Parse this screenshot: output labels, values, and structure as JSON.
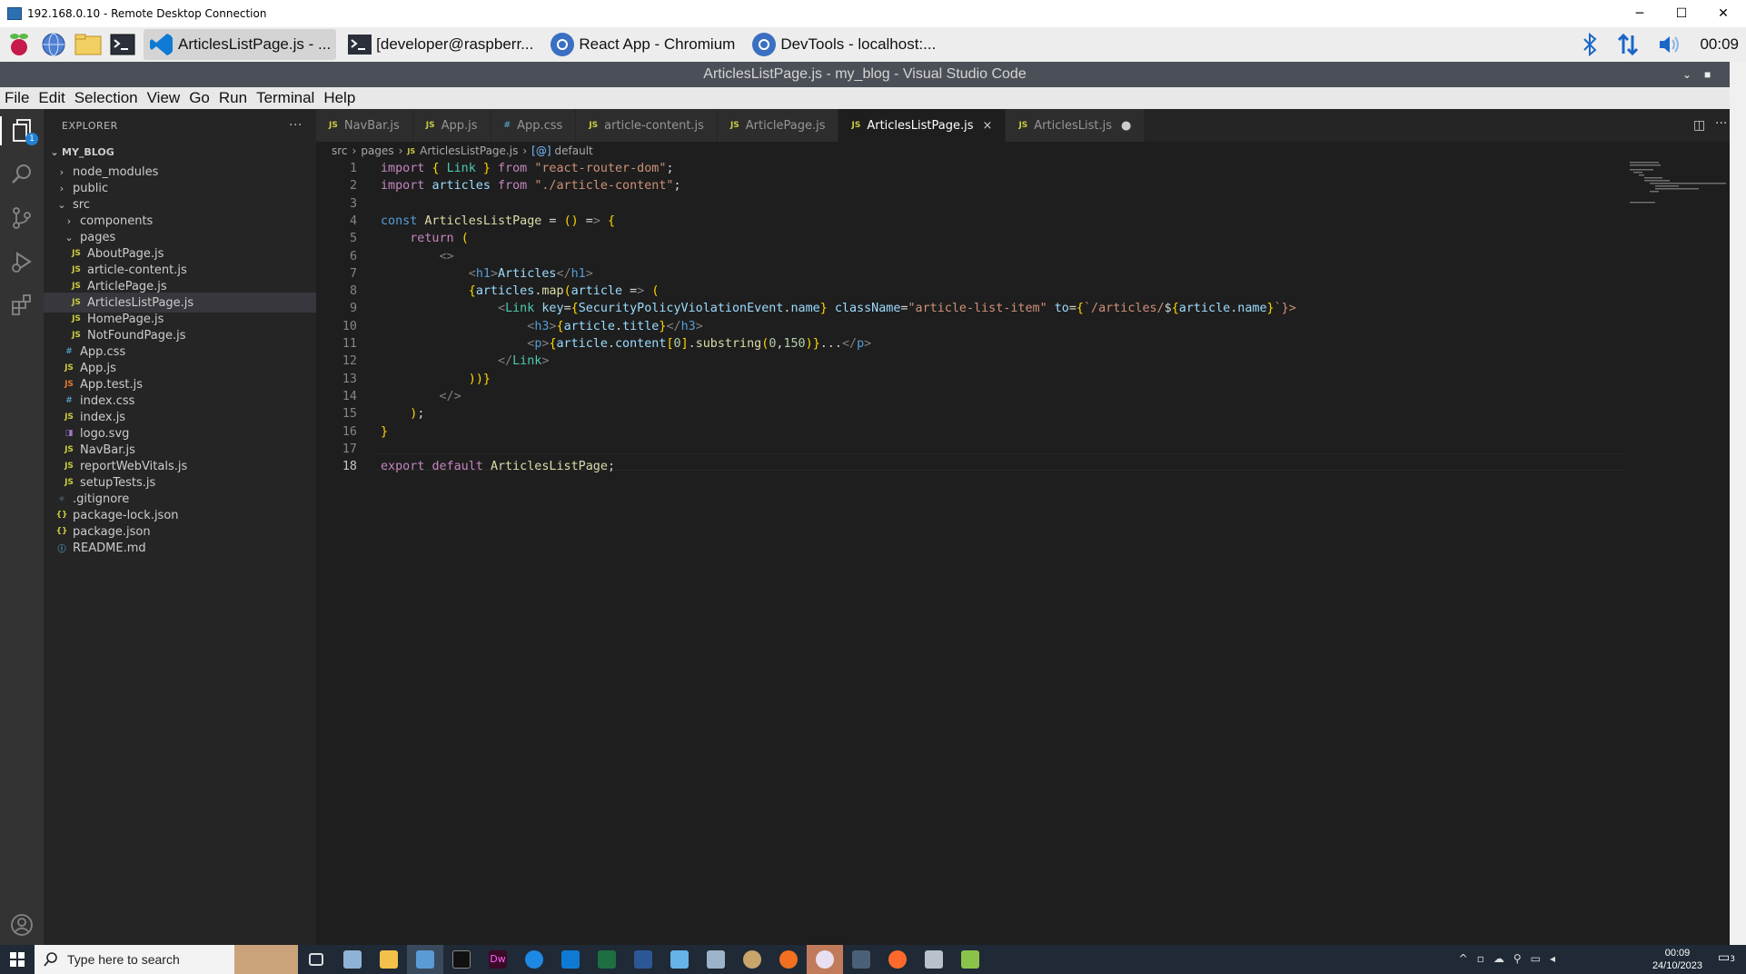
{
  "rdp": {
    "title": "192.168.0.10 - Remote Desktop Connection",
    "minimize": "─",
    "maximize": "☐",
    "close": "✕"
  },
  "pi_taskbar": {
    "tasks": [
      {
        "label": "ArticlesListPage.js - ..."
      },
      {
        "label": "[developer@raspberr..."
      },
      {
        "label": "React App - Chromium"
      },
      {
        "label": "DevTools - localhost:..."
      }
    ],
    "clock": "00:09"
  },
  "vscode": {
    "title": "ArticlesListPage.js - my_blog - Visual Studio Code",
    "menu": [
      "File",
      "Edit",
      "Selection",
      "View",
      "Go",
      "Run",
      "Terminal",
      "Help"
    ],
    "explorer": {
      "header": "EXPLORER",
      "more": "···",
      "root": "MY_BLOG",
      "source_control_badge": "1",
      "items": [
        {
          "label": "node_modules",
          "kind": "folder",
          "level": 1,
          "open": false
        },
        {
          "label": "public",
          "kind": "folder",
          "level": 1,
          "open": false
        },
        {
          "label": "src",
          "kind": "folder",
          "level": 1,
          "open": true
        },
        {
          "label": "components",
          "kind": "folder",
          "level": 2,
          "open": false
        },
        {
          "label": "pages",
          "kind": "folder",
          "level": 2,
          "open": true
        },
        {
          "label": "AboutPage.js",
          "kind": "js",
          "level": 3
        },
        {
          "label": "article-content.js",
          "kind": "js",
          "level": 3
        },
        {
          "label": "ArticlePage.js",
          "kind": "js",
          "level": 3
        },
        {
          "label": "ArticlesListPage.js",
          "kind": "js",
          "level": 3,
          "selected": true
        },
        {
          "label": "HomePage.js",
          "kind": "js",
          "level": 3
        },
        {
          "label": "NotFoundPage.js",
          "kind": "js",
          "level": 3
        },
        {
          "label": "App.css",
          "kind": "css",
          "level": 2
        },
        {
          "label": "App.js",
          "kind": "js",
          "level": 2
        },
        {
          "label": "App.test.js",
          "kind": "jstest",
          "level": 2
        },
        {
          "label": "index.css",
          "kind": "css",
          "level": 2
        },
        {
          "label": "index.js",
          "kind": "js",
          "level": 2
        },
        {
          "label": "logo.svg",
          "kind": "svg",
          "level": 2
        },
        {
          "label": "NavBar.js",
          "kind": "js",
          "level": 2
        },
        {
          "label": "reportWebVitals.js",
          "kind": "js",
          "level": 2
        },
        {
          "label": "setupTests.js",
          "kind": "js",
          "level": 2
        },
        {
          "label": ".gitignore",
          "kind": "git",
          "level": 1
        },
        {
          "label": "package-lock.json",
          "kind": "json",
          "level": 1
        },
        {
          "label": "package.json",
          "kind": "json",
          "level": 1
        },
        {
          "label": "README.md",
          "kind": "md",
          "level": 1
        }
      ]
    },
    "tabs": [
      {
        "label": "NavBar.js",
        "kind": "js"
      },
      {
        "label": "App.js",
        "kind": "js"
      },
      {
        "label": "App.css",
        "kind": "css"
      },
      {
        "label": "article-content.js",
        "kind": "js"
      },
      {
        "label": "ArticlePage.js",
        "kind": "js"
      },
      {
        "label": "ArticlesListPage.js",
        "kind": "js",
        "active": true
      },
      {
        "label": "ArticlesList.js",
        "kind": "js",
        "dirty": true
      }
    ],
    "breadcrumb": [
      "src",
      "pages",
      "ArticlesListPage.js",
      "default"
    ],
    "cursor_line": "18",
    "code": [
      "import { Link } from \"react-router-dom\";",
      "import articles from \"./article-content\";",
      "",
      "const ArticlesListPage = () => {",
      "    return (",
      "        <>",
      "            <h1>Articles</h1>",
      "            {articles.map(article => (",
      "                <Link key={SecurityPolicyViolationEvent.name} className=\"article-list-item\" to={`/articles/${article.name}`}>",
      "                    <h3>{article.title}</h3>",
      "                    <p>{article.content[0].substring(0,150)}...</p>",
      "                </Link>",
      "            ))}",
      "        </>",
      "    );",
      "}",
      "",
      "export default ArticlesListPage;"
    ]
  },
  "windows": {
    "search_placeholder": "Type here to search",
    "time": "00:09",
    "date": "24/10/2023",
    "notification_count": "3"
  }
}
